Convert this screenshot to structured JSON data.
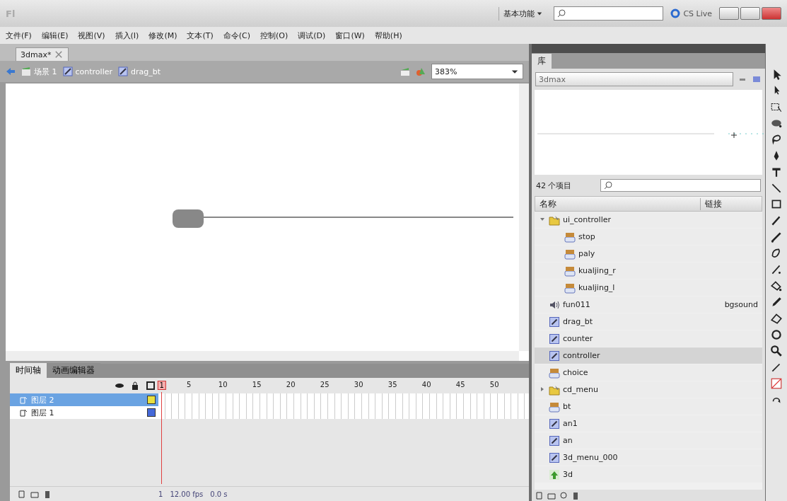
{
  "title_bar": {
    "app_logo": "Fl",
    "workspace": "基本功能",
    "cs_live": "CS Live"
  },
  "menu": [
    "文件(F)",
    "编辑(E)",
    "视图(V)",
    "插入(I)",
    "修改(M)",
    "文本(T)",
    "命令(C)",
    "控制(O)",
    "调试(D)",
    "窗口(W)",
    "帮助(H)"
  ],
  "document_tab": {
    "title": "3dmax*"
  },
  "breadcrumb": [
    {
      "label": "场景 1",
      "kind": "scene"
    },
    {
      "label": "controller",
      "kind": "symbol"
    },
    {
      "label": "drag_bt",
      "kind": "symbol"
    }
  ],
  "zoom": "383%",
  "timeline": {
    "tabs": [
      {
        "label": "时间轴",
        "selected": true
      },
      {
        "label": "动画编辑器",
        "selected": false
      }
    ],
    "frame_numbers": [
      "1",
      "5",
      "10",
      "15",
      "20",
      "25",
      "30",
      "35",
      "40",
      "45",
      "50"
    ],
    "layers": [
      {
        "name": "图层 2",
        "selected": true,
        "color": "#e8e040"
      },
      {
        "name": "图层 1",
        "selected": false,
        "color": "#4468d8"
      }
    ],
    "status": {
      "frame": "1",
      "fps": "12.00 fps",
      "time": "0.0 s"
    }
  },
  "library": {
    "tab": "库",
    "document": "3dmax",
    "count": "42 个项目",
    "columns": [
      "名称",
      "链接"
    ],
    "items": [
      {
        "name": "ui_controller",
        "kind": "folder",
        "expanded": true,
        "selected": false,
        "children": [
          {
            "name": "stop",
            "kind": "button",
            "selected": false
          },
          {
            "name": "paly",
            "kind": "button",
            "selected": false
          },
          {
            "name": "kualjing_r",
            "kind": "button",
            "selected": false
          },
          {
            "name": "kualjing_l",
            "kind": "button",
            "selected": false
          }
        ]
      },
      {
        "name": "fun011",
        "kind": "sound",
        "selected": false,
        "linkage": "bgsound"
      },
      {
        "name": "drag_bt",
        "kind": "movieclip",
        "selected": false
      },
      {
        "name": "counter",
        "kind": "movieclip",
        "selected": false
      },
      {
        "name": "controller",
        "kind": "movieclip",
        "selected": true
      },
      {
        "name": "choice",
        "kind": "button",
        "selected": false
      },
      {
        "name": "cd_menu",
        "kind": "folder",
        "expanded": false,
        "selected": false
      },
      {
        "name": "bt",
        "kind": "button",
        "selected": false
      },
      {
        "name": "an1",
        "kind": "movieclip",
        "selected": false
      },
      {
        "name": "an",
        "kind": "movieclip",
        "selected": false
      },
      {
        "name": "3d_menu_000",
        "kind": "movieclip",
        "selected": false
      },
      {
        "name": "3d",
        "kind": "bitmap",
        "selected": false
      }
    ]
  }
}
